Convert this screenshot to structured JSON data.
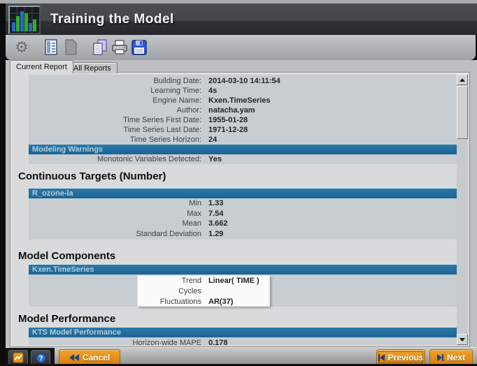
{
  "titlebar": {
    "title": "Training the Model",
    "app_icon": "bar-chart-icon"
  },
  "toolbar": {
    "icons": [
      {
        "name": "settings-gear-icon",
        "disabled": true
      },
      {
        "name": "report-icon",
        "disabled": false
      },
      {
        "name": "document-icon",
        "disabled": true
      },
      {
        "name": "copy-icon",
        "disabled": false
      },
      {
        "name": "print-icon",
        "disabled": false
      },
      {
        "name": "save-icon",
        "disabled": false
      }
    ]
  },
  "tabs": {
    "current": "Current Report",
    "all": "All Reports"
  },
  "report": {
    "info": {
      "rows": [
        {
          "label": "Building Date:",
          "value": "2014-03-10 14:11:54"
        },
        {
          "label": "Learning Time:",
          "value": "4s"
        },
        {
          "label": "Engine Name:",
          "value": "Kxen.TimeSeries"
        },
        {
          "label": "Author:",
          "value": "natacha.yam"
        },
        {
          "label": "Time Series First Date:",
          "value": "1955-01-28"
        },
        {
          "label": "Time Series Last Date:",
          "value": "1971-12-28"
        },
        {
          "label": "Time Series Horizon:",
          "value": "24"
        }
      ]
    },
    "modeling_warnings": {
      "header": "Modeling Warnings",
      "rows": [
        {
          "label": "Monotonic Variables Detected:",
          "value": "Yes"
        }
      ]
    },
    "continuous_targets": {
      "heading": "Continuous Targets (Number)",
      "header": "R_ozone-la",
      "rows": [
        {
          "label": "Min",
          "value": "1.33"
        },
        {
          "label": "Max",
          "value": "7.54"
        },
        {
          "label": "Mean",
          "value": "3.662"
        },
        {
          "label": "Standard Deviation",
          "value": "1.29"
        }
      ]
    },
    "model_components": {
      "heading": "Model Components",
      "header": "Kxen.TimeSeries",
      "rows": [
        {
          "label": "Trend",
          "value": "Linear( TIME )"
        },
        {
          "label": "Cycles",
          "value": ""
        },
        {
          "label": "Fluctuations",
          "value": "AR(37)"
        }
      ]
    },
    "model_performance": {
      "heading": "Model Performance",
      "header": "KTS Model Performance",
      "rows": [
        {
          "label": "Horizon-wide MAPE",
          "value": "0.178"
        }
      ]
    }
  },
  "footer": {
    "cancel_label": "Cancel",
    "previous_label": "Previous",
    "next_label": "Next"
  },
  "colors": {
    "section_header_bg": "#2171a1",
    "accent_orange": "#e8941c",
    "titlebar_dark": "#2a2d30",
    "row_gray": "#c8cdd2"
  }
}
